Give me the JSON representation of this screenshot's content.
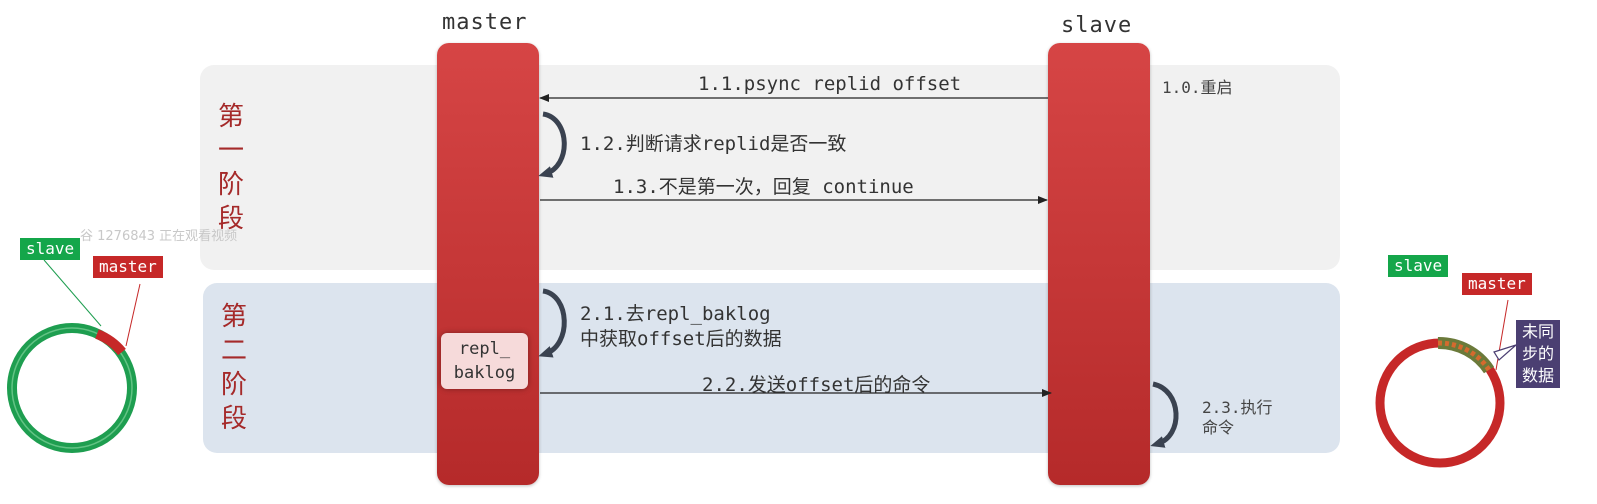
{
  "phases": {
    "phase1": "第\n一\n阶\n段",
    "phase2": "第\n二\n阶\n段"
  },
  "lanes": {
    "master": "master",
    "slave": "slave"
  },
  "steps": {
    "s1_0": "1.0.重启",
    "s1_1": "1.1.psync replid offset",
    "s1_2": "1.2.判断请求replid是否一致",
    "s1_3": "1.3.不是第一次，回复 continue",
    "s2_1_line1": "2.1.去repl_baklog",
    "s2_1_line2": "中获取offset后的数据",
    "s2_2": "2.2.发送offset后的命令",
    "s2_3_line1": "2.3.执行",
    "s2_3_line2": "命令"
  },
  "backlog": {
    "line1": "repl_",
    "line2": "baklog"
  },
  "left_ring": {
    "slave_tag": "slave",
    "master_tag": "master"
  },
  "right_ring": {
    "slave_tag": "slave",
    "master_tag": "master",
    "unsynced_label": "未同\n步的\n数据"
  },
  "watermark": "谷 1276843 正在观看视频",
  "colors": {
    "lane_red": "#c83a3a",
    "phase1_bg": "#f1f1f1",
    "phase2_bg": "#dce4ee",
    "phase_title": "#a52a2a",
    "ring_green": "#1e9e50",
    "ring_red": "#c62828",
    "unsynced_purple": "#4b3f72"
  }
}
